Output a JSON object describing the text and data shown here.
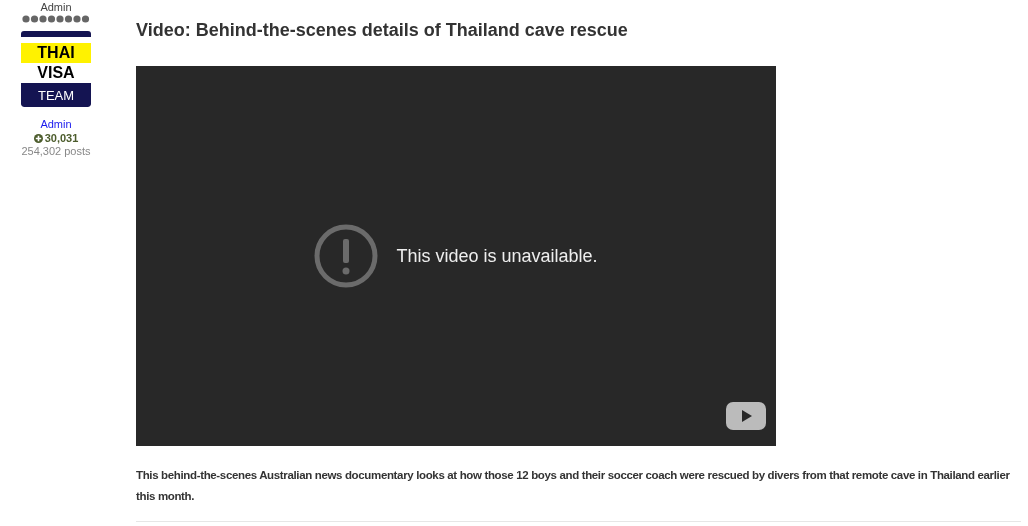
{
  "author": {
    "title": "Admin",
    "logo": [
      "THAI",
      "VISA",
      "TEAM"
    ],
    "name": "Admin",
    "reputation": "30,031",
    "posts": "254,302 posts"
  },
  "post": {
    "title": "Video: Behind-the-scenes details of Thailand cave rescue",
    "video": {
      "message": "This video is unavailable."
    },
    "body": "This behind-the-scenes Australian news documentary looks at how those 12 boys and their soccer coach were rescued by divers from that remote cave in Thailand earlier this month."
  }
}
